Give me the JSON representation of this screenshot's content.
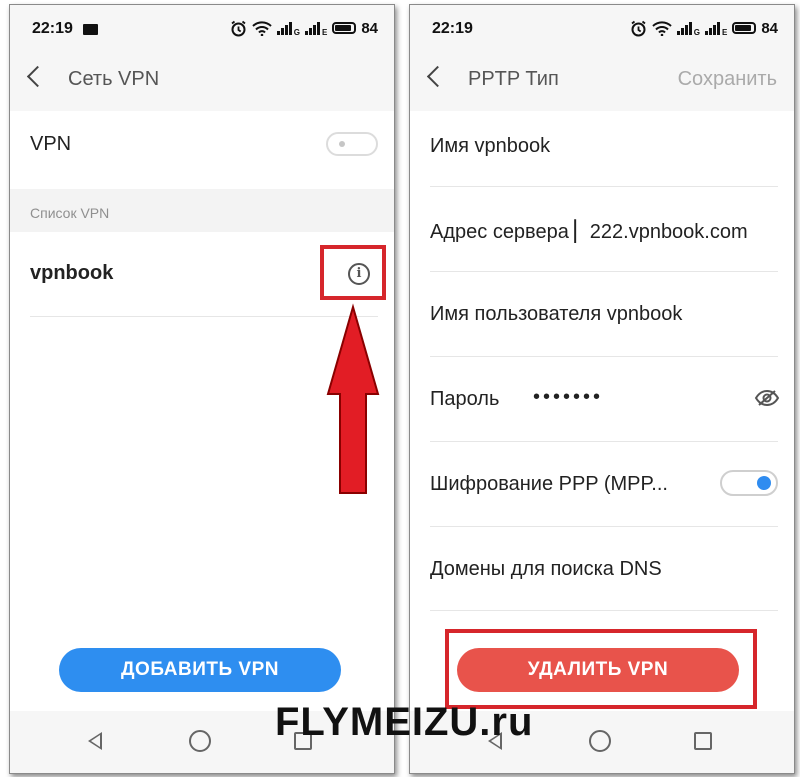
{
  "status_bar": {
    "time": "22:19",
    "battery": "84",
    "net_letters": [
      "G",
      "E"
    ]
  },
  "screen_left": {
    "title": "Сеть VPN",
    "vpn_toggle_label": "VPN",
    "vpn_toggle_on": false,
    "section_header": "Список VPN",
    "vpn_items": [
      {
        "name": "vpnbook"
      }
    ],
    "add_button": "ДОБАВИТЬ VPN"
  },
  "screen_right": {
    "title": "PPTP Тип",
    "save_button": "Сохранить",
    "fields": {
      "name": "Имя vpnbook",
      "server": "Адрес сервера ▏222.vpnbook.com",
      "username": "Имя пользователя vpnbook",
      "password_label": "Пароль",
      "password_value": "•••••••",
      "encryption": "Шифрование PPP (MPP...",
      "dns": "Домены для поиска DNS"
    },
    "encryption_on": true,
    "delete_button": "УДАЛИТЬ VPN"
  },
  "watermark": "FLYMEIZU.ru",
  "colors": {
    "accent_blue": "#2f8cf0",
    "add_button": "#2e8ef0",
    "delete_button": "#e8534b",
    "highlight_red": "#d6262b",
    "arrow_red": "#e21d25"
  },
  "icons": [
    "back-chevron-icon",
    "info-icon",
    "eye-icon",
    "alarm-icon",
    "wifi-icon",
    "signal-icon",
    "battery-icon",
    "image-icon"
  ]
}
